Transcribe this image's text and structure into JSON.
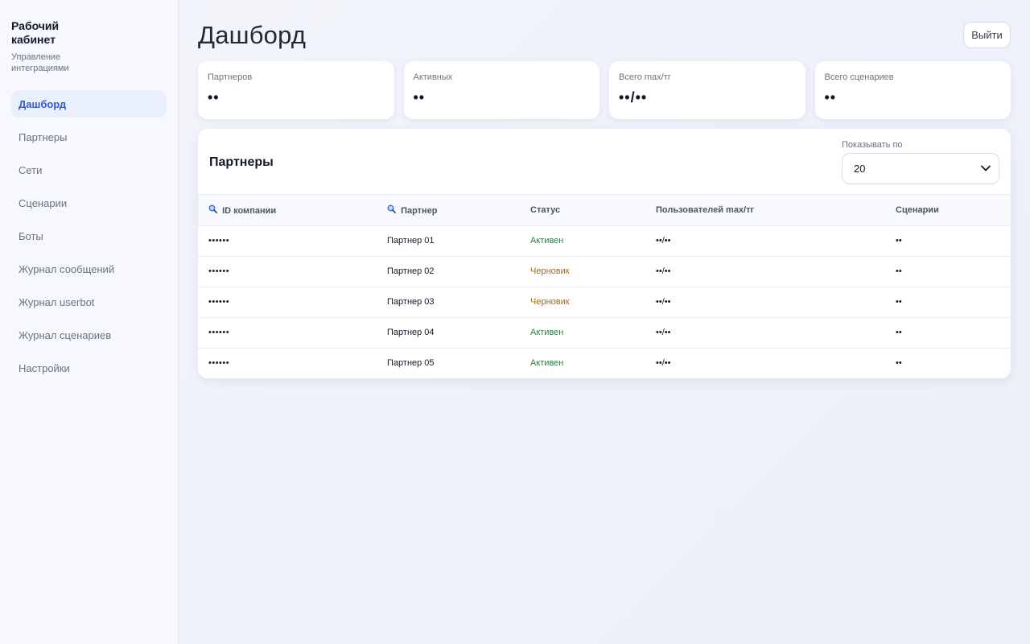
{
  "sidebar": {
    "title": "Рабочий кабинет",
    "subtitle": "Управление интеграциями",
    "items": [
      {
        "label": "Дашборд",
        "active": true
      },
      {
        "label": "Партнеры"
      },
      {
        "label": "Сети"
      },
      {
        "label": "Сценарии"
      },
      {
        "label": "Боты"
      },
      {
        "label": "Журнал сообщений"
      },
      {
        "label": "Журнал userbot"
      },
      {
        "label": "Журнал сценариев"
      },
      {
        "label": "Настройки"
      }
    ]
  },
  "header": {
    "title": "Дашборд",
    "logout_label": "Выйти"
  },
  "stats": [
    {
      "label": "Партнеров",
      "value": "••"
    },
    {
      "label": "Активных",
      "value": "••"
    },
    {
      "label": "Всего max/тг",
      "value": "••/••"
    },
    {
      "label": "Всего сценариев",
      "value": "••"
    }
  ],
  "partners_table": {
    "title": "Партнеры",
    "per_page_label": "Показывать по",
    "per_page_value": "20",
    "columns": [
      "ID компании",
      "Партнер",
      "Статус",
      "Пользователей max/тг",
      "Сценарии"
    ],
    "rows": [
      {
        "id": "••••••",
        "name": "Партнер 01",
        "status": "Активен",
        "users": "••/••",
        "scenarios": "••"
      },
      {
        "id": "••••••",
        "name": "Партнер 02",
        "status": "Черновик",
        "users": "••/••",
        "scenarios": "••"
      },
      {
        "id": "••••••",
        "name": "Партнер 03",
        "status": "Черновик",
        "users": "••/••",
        "scenarios": "••"
      },
      {
        "id": "••••••",
        "name": "Партнер 04",
        "status": "Активен",
        "users": "••/••",
        "scenarios": "••"
      },
      {
        "id": "••••••",
        "name": "Партнер 05",
        "status": "Активен",
        "users": "••/••",
        "scenarios": "••"
      }
    ]
  },
  "colors": {
    "accent": "#2f5bd3",
    "status_active": "#1f8a3d",
    "status_draft": "#a36a10"
  },
  "icons": {
    "column_search": "magnifier-icon",
    "select_arrow": "chevron-down-icon"
  }
}
